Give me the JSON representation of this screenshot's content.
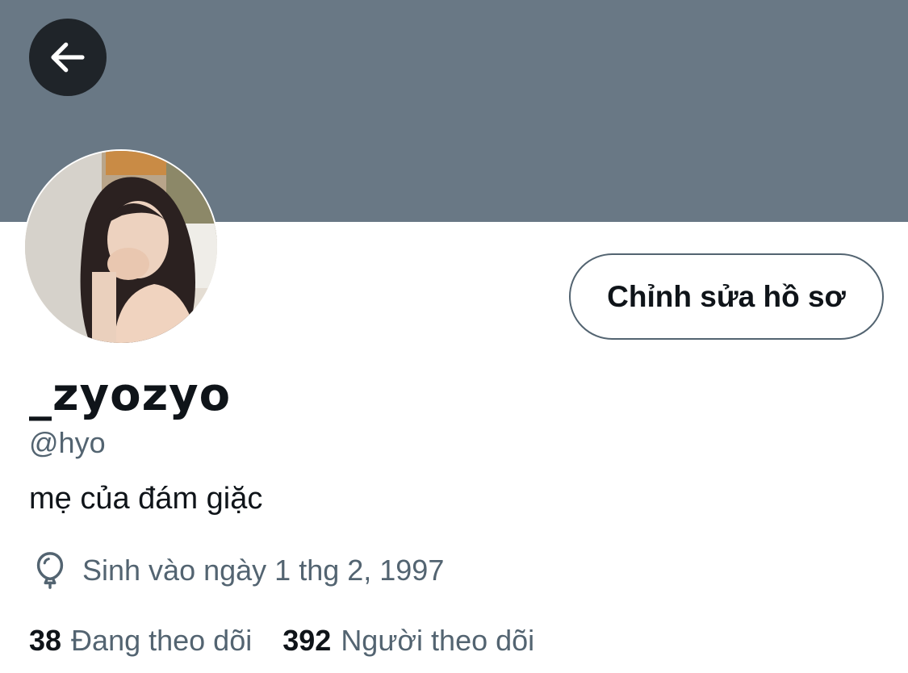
{
  "profile": {
    "display_name": "_zyozyo",
    "handle": "@hyo",
    "bio": "mẹ của đám giặc",
    "birth": "Sinh vào ngày 1 thg 2, 1997",
    "edit_label": "Chỉnh sửa hồ sơ"
  },
  "stats": {
    "following_count": "38",
    "following_label": "Đang theo dõi",
    "followers_count": "392",
    "followers_label": "Người theo dõi"
  },
  "icons": {
    "back": "arrow-left-icon",
    "birth": "balloon-icon"
  },
  "colors": {
    "banner": "#697885",
    "back_button_bg": "#1f2429",
    "secondary_text": "#536471",
    "primary_text": "#0f1419"
  }
}
